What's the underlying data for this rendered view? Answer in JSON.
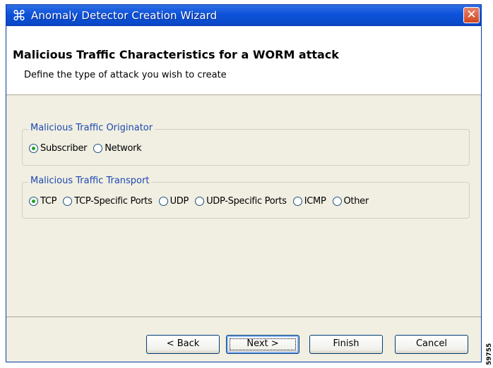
{
  "window": {
    "title": "Anomaly Detector Creation Wizard",
    "app_icon": "wizard-app-icon",
    "close_icon": "close-icon"
  },
  "header": {
    "title": "Malicious Traffic Characteristics for a WORM attack",
    "description": "Define the type of attack you wish to create"
  },
  "originator": {
    "legend": "Malicious Traffic Originator",
    "options": [
      {
        "label": "Subscriber",
        "checked": true
      },
      {
        "label": "Network",
        "checked": false
      }
    ]
  },
  "transport": {
    "legend": "Malicious Traffic Transport",
    "options": [
      {
        "label": "TCP",
        "checked": true
      },
      {
        "label": "TCP-Specific Ports",
        "checked": false
      },
      {
        "label": "UDP",
        "checked": false
      },
      {
        "label": "UDP-Specific Ports",
        "checked": false
      },
      {
        "label": "ICMP",
        "checked": false
      },
      {
        "label": "Other",
        "checked": false
      }
    ]
  },
  "buttons": {
    "back": "< Back",
    "next": "Next >",
    "finish": "Finish",
    "cancel": "Cancel"
  },
  "side_code": "59755"
}
